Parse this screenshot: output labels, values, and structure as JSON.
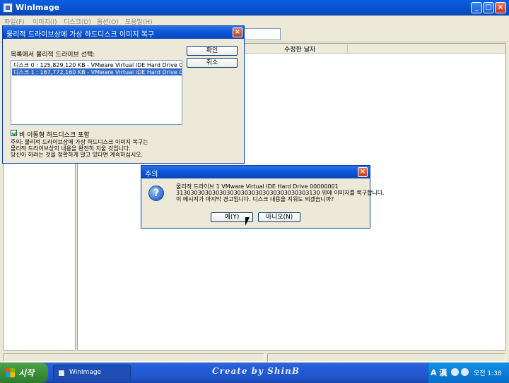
{
  "window": {
    "title": "WinImage"
  },
  "menu": [
    "파일(F)",
    "이미지(I)",
    "디스크(D)",
    "옵션(O)",
    "도움말(H)"
  ],
  "columns": {
    "modified": "수정한 날자"
  },
  "restore_dialog": {
    "title": "물리적 드라이브상에 가상 하드디스크 이미지 복구",
    "list_label": "목록에서 물리적 드라이브 선택:",
    "drives": [
      {
        "label": "디스크 0 : 125,829,120 KB - VMware Virtual IDE Hard Drive 00",
        "selected": false
      },
      {
        "label": "디스크 1 : 167,772,160 KB - VMware Virtual IDE Hard Drive 00",
        "selected": true
      }
    ],
    "ok_label": "확인",
    "cancel_label": "취소",
    "checkbox_label": "비 이동형 하드디스크 포함",
    "checkbox_checked": true,
    "note_lines": [
      "주의: 물리적 드라이브상에 가상 하드디스크 이미지 복구는",
      "물리적 드라이브상의 내용을 완전히 지울 것입니다.",
      "당신이 하려는 것을 정확하게 알고 있다면 계속하십시오."
    ]
  },
  "alert_dialog": {
    "title": "주의",
    "lines": [
      "물리적 드라이브 1 VMware Virtual IDE Hard Drive 00000001",
      "3130303030303030303030303030303030303130 위에 이미지를 복구합니다.",
      "이 메시지가 마지막 경고입니다. 디스크 내용을 지워도 되겠습니까?"
    ],
    "yes_label": "예(Y)",
    "no_label": "아니오(N)"
  },
  "taskbar": {
    "start_label": "시작",
    "task_label": "WinImage",
    "watermark": "Create by ShinB",
    "lang": "A 漢",
    "clock": "오전 1:38"
  },
  "icons": {
    "app": "winimage-icon",
    "alert": "question-icon",
    "start": "windows-logo-icon"
  }
}
